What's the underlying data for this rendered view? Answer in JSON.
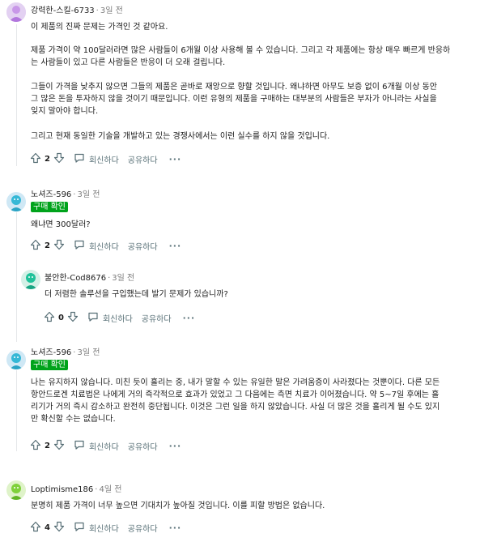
{
  "actions": {
    "reply": "회신하다",
    "share": "공유하다",
    "more": "···"
  },
  "comments": [
    {
      "author": "강력한-스킬-6733",
      "time": "3일 전",
      "paragraphs": [
        "이 제품의 진짜 문제는 가격인 것 같아요.",
        "제품 가격이 약 100달러라면 많은 사람들이 6개월 이상 사용해 볼 수 있습니다. 그리고 각 제품에는 항상 매우 빠르게 반응하는 사람들이 있고 다른 사람들은 반응이 더 오래 걸립니다.",
        "그들이 가격을 낮추지 않으면 그들의 제품은 곧바로 재앙으로 향할 것입니다. 왜냐하면 아무도 보증 없이 6개월 이상 동안 그 많은 돈을 투자하지 않을 것이기 때문입니다. 이런 유형의 제품을 구매하는 대부분의 사람들은 부자가 아니라는 사실을 잊지 말아야 합니다.",
        "그리고 현재 동일한 기술을 개발하고 있는 경쟁사에서는 이런 실수를 하지 않을 것입니다."
      ],
      "votes": "2"
    },
    {
      "author": "노셔즈-596",
      "time": "3일 전",
      "badge": "구매 확인",
      "paragraphs": [
        "왜냐면 300달러?"
      ],
      "votes": "2"
    },
    {
      "author": "불안한-Cod8676",
      "time": "3일 전",
      "paragraphs": [
        "더 저렴한 솔루션을 구입했는데 발기 문제가 있습니까?"
      ],
      "votes": "0"
    },
    {
      "author": "노셔즈-596",
      "time": "3일 전",
      "badge": "구매 확인",
      "paragraphs": [
        "나는 유지하지 않습니다. 미친 듯이 흘리는 중, 내가 말할 수 있는 유일한 말은 가려움증이 사라졌다는 것뿐이다. 다른 모든 항안드로겐 치료법은 나에게 거의 즉각적으로 효과가 있었고 그 다음에는 측면 치료가 이어졌습니다. 약 5~7일 후에는 흘리기가 거의 즉시 감소하고 완전히 중단됩니다. 이것은 그런 일을 하지 않았습니다. 사실 더 많은 것을 흘리게 될 수도 있지만 확신할 수는 없습니다."
      ],
      "votes": "2"
    },
    {
      "author": "Loptimisme186",
      "time": "4일 전",
      "paragraphs": [
        "분명히 제품 가격이 너무 높으면 기대치가 높아질 것입니다. 이를 피할 방법은 없습니다."
      ],
      "votes": "4"
    }
  ]
}
